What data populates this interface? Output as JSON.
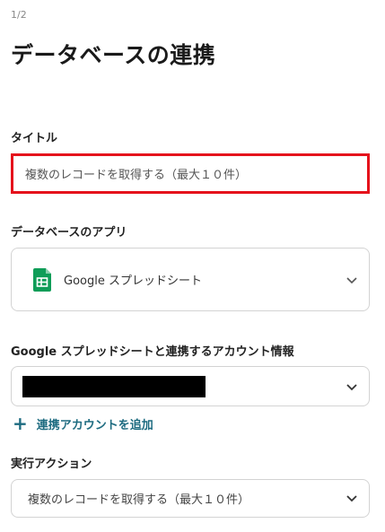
{
  "step": "1/2",
  "page_title": "データベースの連携",
  "title_section": {
    "label": "タイトル",
    "value": "複数のレコードを取得する（最大１０件）"
  },
  "app_section": {
    "label": "データベースのアプリ",
    "selected": "Google スプレッドシート"
  },
  "account_section": {
    "label": "Google スプレッドシートと連携するアカウント情報",
    "add_label": "連携アカウントを追加",
    "add_icon": "+"
  },
  "action_section": {
    "label": "実行アクション",
    "selected": "複数のレコードを取得する（最大１０件）"
  },
  "colors": {
    "highlight_border": "#e5121c",
    "link": "#1d6b80",
    "sheets_green": "#0f9d58"
  }
}
